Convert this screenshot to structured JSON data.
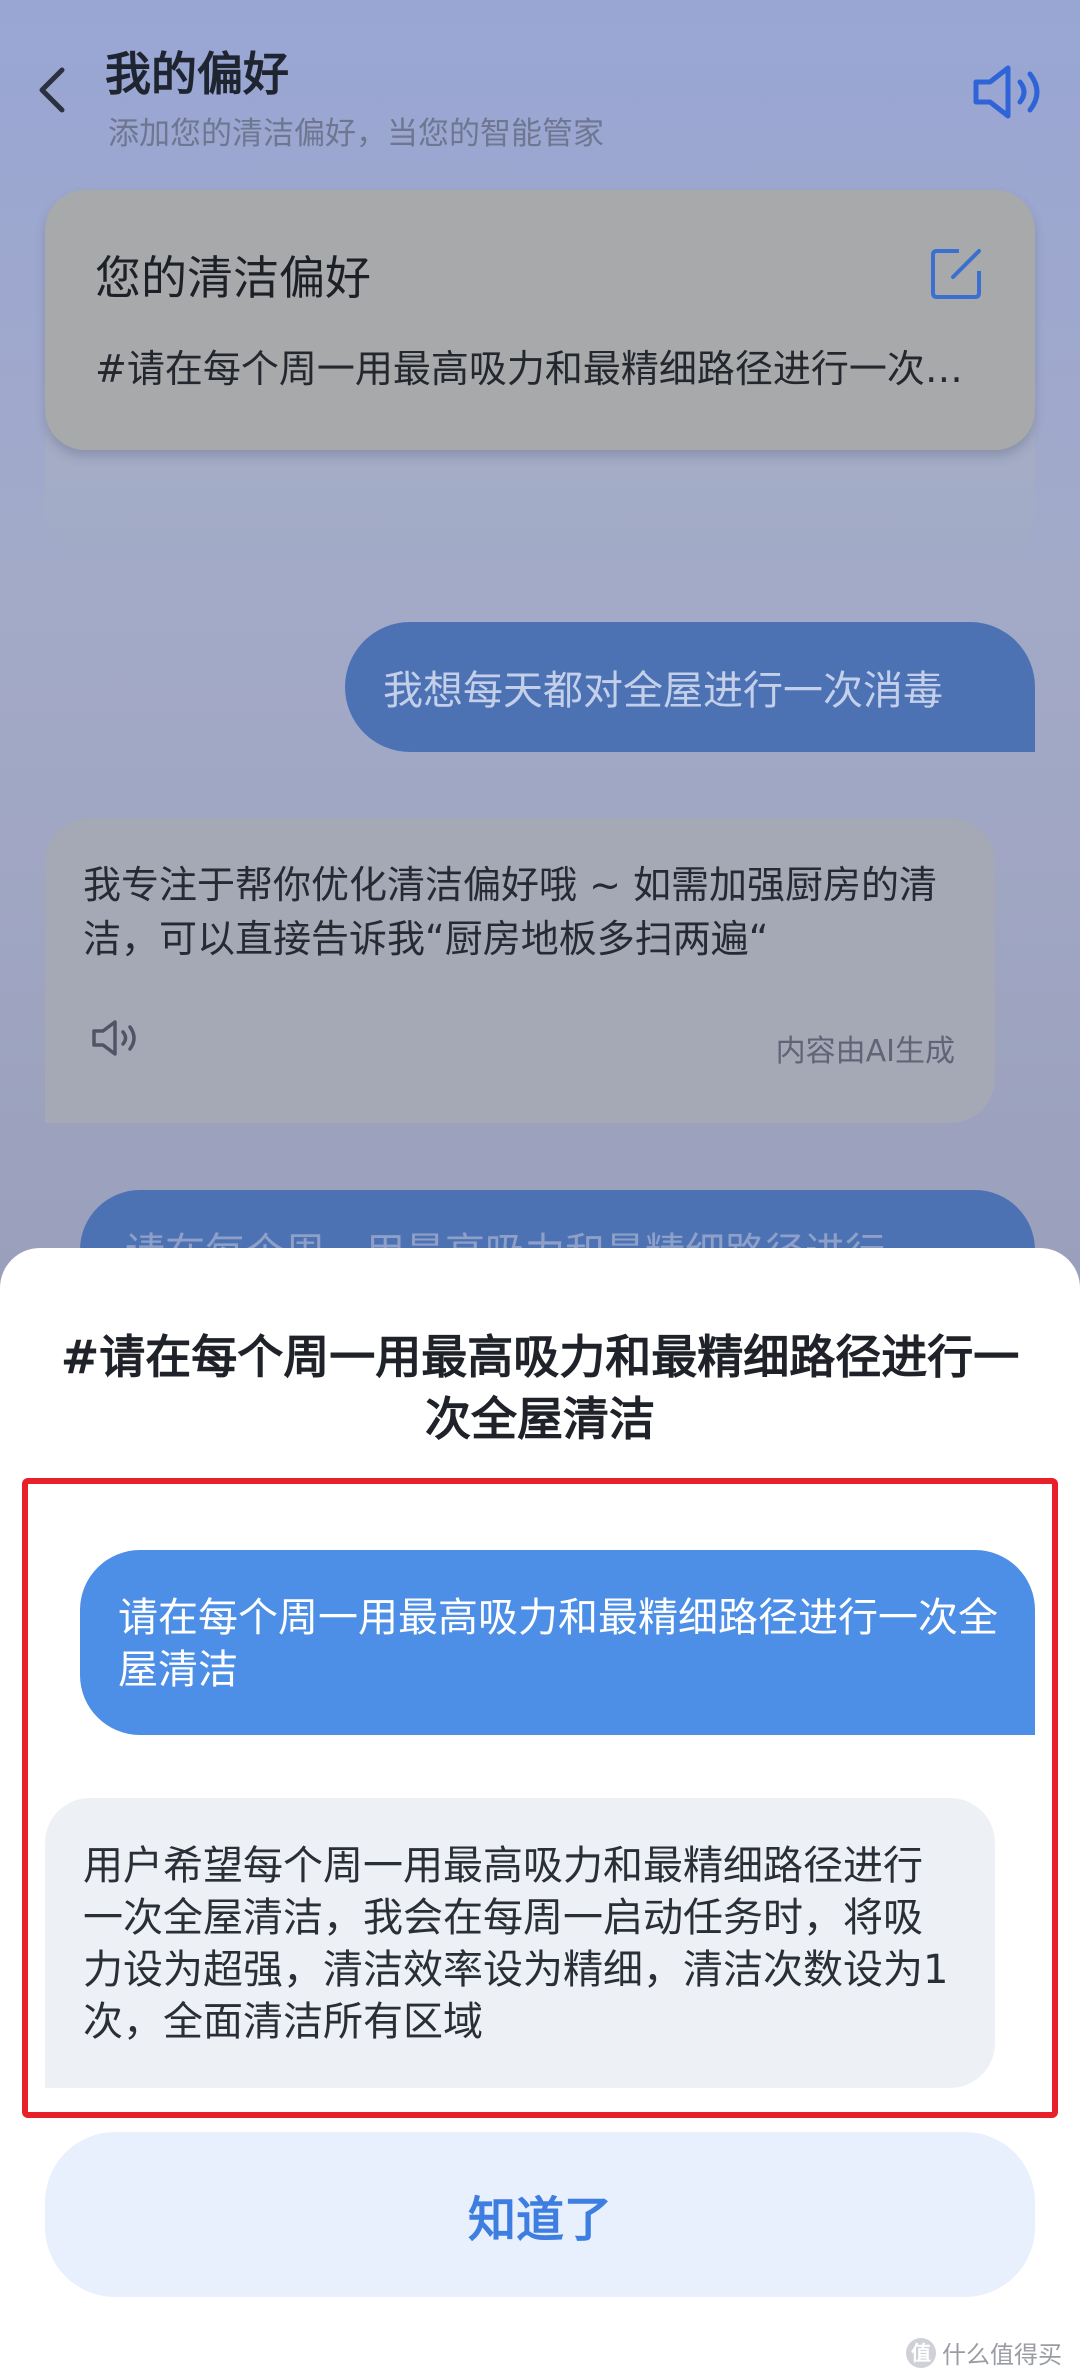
{
  "header": {
    "title": "我的偏好",
    "subtitle": "添加您的清洁偏好，当您的智能管家"
  },
  "preference_card": {
    "title": "您的清洁偏好",
    "text": "#请在每个周一用最高吸力和最精细路径进行一次全屋清洁"
  },
  "chat": {
    "user_message_1": "我想每天都对全屋进行一次消毒",
    "ai_message_1": "我专注于帮你优化清洁偏好哦 ~ 如需加强厨房的清洁，可以直接告诉我“厨房地板多扫两遍“",
    "ai_note": "内容由AI生成",
    "user_message_2_partial": "请在每个周一用最高吸力和最精细路径进行"
  },
  "sheet": {
    "title": "#请在每个周一用最高吸力和最精细路径进行一次全屋清洁",
    "user_message": "请在每个周一用最高吸力和最精细路径进行一次全屋清洁",
    "ai_reply": "用户希望每个周一用最高吸力和最精细路径进行一次全屋清洁，我会在每周一启动任务时，将吸力设为超强，清洁效率设为精细，清洁次数设为1次，全面清洁所有区域",
    "ok_label": "知道了"
  },
  "watermark": {
    "badge": "值",
    "text": "什么值得买"
  },
  "colors": {
    "user_bubble": "#4d8fe6",
    "ai_bubble": "#edf0f5",
    "button_bg": "#e8f0fd",
    "button_text": "#3e7ee0",
    "highlight": "#e8202a"
  }
}
